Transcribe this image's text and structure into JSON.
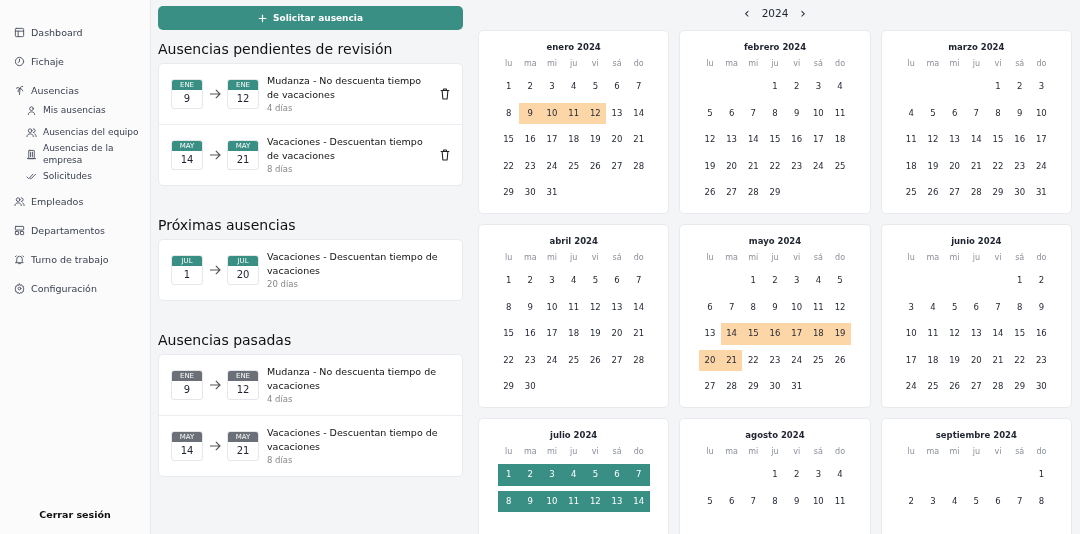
{
  "sidebar": {
    "items": [
      {
        "label": "Dashboard"
      },
      {
        "label": "Fichaje"
      },
      {
        "label": "Ausencias",
        "children": [
          {
            "label": "Mis ausencias"
          },
          {
            "label": "Ausencias del equipo"
          },
          {
            "label": "Ausencias de la empresa"
          },
          {
            "label": "Solicitudes"
          }
        ]
      },
      {
        "label": "Empleados"
      },
      {
        "label": "Departamentos"
      },
      {
        "label": "Turno de trabajo"
      },
      {
        "label": "Configuración"
      }
    ],
    "logout": "Cerrar sesión"
  },
  "request_button": "Solicitar ausencia",
  "sections": [
    {
      "title": "Ausencias pendientes de revisión",
      "kind": "pending",
      "items": [
        {
          "from": {
            "month": "ENE",
            "day": "9"
          },
          "to": {
            "month": "ENE",
            "day": "12"
          },
          "title": "Mudanza - No descuenta tiempo de vacaciones",
          "duration": "4 días",
          "deletable": true
        },
        {
          "from": {
            "month": "MAY",
            "day": "14"
          },
          "to": {
            "month": "MAY",
            "day": "21"
          },
          "title": "Vacaciones - Descuentan tiempo de vacaciones",
          "duration": "8 días",
          "deletable": true
        }
      ]
    },
    {
      "title": "Próximas ausencias",
      "kind": "upcoming",
      "items": [
        {
          "from": {
            "month": "JUL",
            "day": "1"
          },
          "to": {
            "month": "JUL",
            "day": "20"
          },
          "title": "Vacaciones - Descuentan tiempo de vacaciones",
          "duration": "20 días",
          "deletable": false
        }
      ]
    },
    {
      "title": "Ausencias pasadas",
      "kind": "past",
      "items": [
        {
          "from": {
            "month": "ENE",
            "day": "9"
          },
          "to": {
            "month": "ENE",
            "day": "12"
          },
          "title": "Mudanza - No descuenta tiempo de vacaciones",
          "duration": "4 días",
          "deletable": false
        },
        {
          "from": {
            "month": "MAY",
            "day": "14"
          },
          "to": {
            "month": "MAY",
            "day": "21"
          },
          "title": "Vacaciones - Descuentan tiempo de vacaciones",
          "duration": "8 días",
          "deletable": false
        }
      ]
    }
  ],
  "calendar": {
    "prev": "‹",
    "year": "2024",
    "next": "›",
    "months": [
      {
        "title": "enero 2024",
        "color": "#fdd6a8",
        "weekdays": [
          "lu",
          "ma",
          "mi",
          "ju",
          "vi",
          "sá",
          "do"
        ],
        "weeks": [
          {
            "kind": "full",
            "days": [
              {
                "d": "1",
                "marked": false
              },
              {
                "d": "2",
                "marked": false
              },
              {
                "d": "3",
                "marked": false
              },
              {
                "d": "4",
                "marked": false
              },
              {
                "d": "5",
                "marked": false
              },
              {
                "d": "6",
                "marked": false
              },
              {
                "d": "7",
                "marked": false
              }
            ]
          },
          {
            "kind": "full",
            "days": [
              {
                "d": "8",
                "marked": false
              },
              {
                "d": "9",
                "marked": true
              },
              {
                "d": "10",
                "marked": true
              },
              {
                "d": "11",
                "marked": true
              },
              {
                "d": "12",
                "marked": true
              },
              {
                "d": "13",
                "marked": false
              },
              {
                "d": "14",
                "marked": false
              }
            ]
          },
          {
            "kind": "full",
            "days": [
              {
                "d": "15",
                "marked": false
              },
              {
                "d": "16",
                "marked": false
              },
              {
                "d": "17",
                "marked": false
              },
              {
                "d": "18",
                "marked": false
              },
              {
                "d": "19",
                "marked": false
              },
              {
                "d": "20",
                "marked": false
              },
              {
                "d": "21",
                "marked": false
              }
            ]
          },
          {
            "kind": "full",
            "days": [
              {
                "d": "22",
                "marked": false
              },
              {
                "d": "23",
                "marked": false
              },
              {
                "d": "24",
                "marked": false
              },
              {
                "d": "25",
                "marked": false
              },
              {
                "d": "26",
                "marked": false
              },
              {
                "d": "27",
                "marked": false
              },
              {
                "d": "28",
                "marked": false
              }
            ]
          },
          {
            "kind": "full",
            "days": [
              {
                "d": "29",
                "marked": false
              },
              {
                "d": "30",
                "marked": false
              },
              {
                "d": "31",
                "marked": false
              }
            ]
          }
        ]
      },
      {
        "title": "febrero 2024",
        "weekdays": [
          "lu",
          "ma",
          "mi",
          "ju",
          "vi",
          "sá",
          "do"
        ],
        "weeks": [
          {
            "kind": "leading",
            "days": [
              {
                "d": "1",
                "marked": false
              },
              {
                "d": "2",
                "marked": false
              },
              {
                "d": "3",
                "marked": false
              },
              {
                "d": "4",
                "marked": false
              }
            ]
          },
          {
            "kind": "full",
            "days": [
              {
                "d": "5",
                "marked": false
              },
              {
                "d": "6",
                "marked": false
              },
              {
                "d": "7",
                "marked": false
              },
              {
                "d": "8",
                "marked": false
              },
              {
                "d": "9",
                "marked": false
              },
              {
                "d": "10",
                "marked": false
              },
              {
                "d": "11",
                "marked": false
              }
            ]
          },
          {
            "kind": "full",
            "days": [
              {
                "d": "12",
                "marked": false
              },
              {
                "d": "13",
                "marked": false
              },
              {
                "d": "14",
                "marked": false
              },
              {
                "d": "15",
                "marked": false
              },
              {
                "d": "16",
                "marked": false
              },
              {
                "d": "17",
                "marked": false
              },
              {
                "d": "18",
                "marked": false
              }
            ]
          },
          {
            "kind": "full",
            "days": [
              {
                "d": "19",
                "marked": false
              },
              {
                "d": "20",
                "marked": false
              },
              {
                "d": "21",
                "marked": false
              },
              {
                "d": "22",
                "marked": false
              },
              {
                "d": "23",
                "marked": false
              },
              {
                "d": "24",
                "marked": false
              },
              {
                "d": "25",
                "marked": false
              }
            ]
          },
          {
            "kind": "full",
            "days": [
              {
                "d": "26",
                "marked": false
              },
              {
                "d": "27",
                "marked": false
              },
              {
                "d": "28",
                "marked": false
              },
              {
                "d": "29",
                "marked": false
              }
            ]
          }
        ]
      },
      {
        "title": "marzo 2024",
        "weekdays": [
          "lu",
          "ma",
          "mi",
          "ju",
          "vi",
          "sá",
          "do"
        ],
        "weeks": [
          {
            "kind": "leading",
            "days": [
              {
                "d": "1",
                "marked": false
              },
              {
                "d": "2",
                "marked": false
              },
              {
                "d": "3",
                "marked": false
              }
            ]
          },
          {
            "kind": "full",
            "days": [
              {
                "d": "4",
                "marked": false
              },
              {
                "d": "5",
                "marked": false
              },
              {
                "d": "6",
                "marked": false
              },
              {
                "d": "7",
                "marked": false
              },
              {
                "d": "8",
                "marked": false
              },
              {
                "d": "9",
                "marked": false
              },
              {
                "d": "10",
                "marked": false
              }
            ]
          },
          {
            "kind": "full",
            "days": [
              {
                "d": "11",
                "marked": false
              },
              {
                "d": "12",
                "marked": false
              },
              {
                "d": "13",
                "marked": false
              },
              {
                "d": "14",
                "marked": false
              },
              {
                "d": "15",
                "marked": false
              },
              {
                "d": "16",
                "marked": false
              },
              {
                "d": "17",
                "marked": false
              }
            ]
          },
          {
            "kind": "full",
            "days": [
              {
                "d": "18",
                "marked": false
              },
              {
                "d": "19",
                "marked": false
              },
              {
                "d": "20",
                "marked": false
              },
              {
                "d": "21",
                "marked": false
              },
              {
                "d": "22",
                "marked": false
              },
              {
                "d": "23",
                "marked": false
              },
              {
                "d": "24",
                "marked": false
              }
            ]
          },
          {
            "kind": "full",
            "days": [
              {
                "d": "25",
                "marked": false
              },
              {
                "d": "26",
                "marked": false
              },
              {
                "d": "27",
                "marked": false
              },
              {
                "d": "28",
                "marked": false
              },
              {
                "d": "29",
                "marked": false
              },
              {
                "d": "30",
                "marked": false
              },
              {
                "d": "31",
                "marked": false
              }
            ]
          }
        ]
      },
      {
        "title": "abril 2024",
        "weekdays": [
          "lu",
          "ma",
          "mi",
          "ju",
          "vi",
          "sá",
          "do"
        ],
        "weeks": [
          {
            "kind": "full",
            "days": [
              {
                "d": "1",
                "marked": false
              },
              {
                "d": "2",
                "marked": false
              },
              {
                "d": "3",
                "marked": false
              },
              {
                "d": "4",
                "marked": false
              },
              {
                "d": "5",
                "marked": false
              },
              {
                "d": "6",
                "marked": false
              },
              {
                "d": "7",
                "marked": false
              }
            ]
          },
          {
            "kind": "full",
            "days": [
              {
                "d": "8",
                "marked": false
              },
              {
                "d": "9",
                "marked": false
              },
              {
                "d": "10",
                "marked": false
              },
              {
                "d": "11",
                "marked": false
              },
              {
                "d": "12",
                "marked": false
              },
              {
                "d": "13",
                "marked": false
              },
              {
                "d": "14",
                "marked": false
              }
            ]
          },
          {
            "kind": "full",
            "days": [
              {
                "d": "15",
                "marked": false
              },
              {
                "d": "16",
                "marked": false
              },
              {
                "d": "17",
                "marked": false
              },
              {
                "d": "18",
                "marked": false
              },
              {
                "d": "19",
                "marked": false
              },
              {
                "d": "20",
                "marked": false
              },
              {
                "d": "21",
                "marked": false
              }
            ]
          },
          {
            "kind": "full",
            "days": [
              {
                "d": "22",
                "marked": false
              },
              {
                "d": "23",
                "marked": false
              },
              {
                "d": "24",
                "marked": false
              },
              {
                "d": "25",
                "marked": false
              },
              {
                "d": "26",
                "marked": false
              },
              {
                "d": "27",
                "marked": false
              },
              {
                "d": "28",
                "marked": false
              }
            ]
          },
          {
            "kind": "full",
            "days": [
              {
                "d": "29",
                "marked": false
              },
              {
                "d": "30",
                "marked": false
              }
            ]
          }
        ]
      },
      {
        "title": "mayo 2024",
        "color": "#fdd6a8",
        "weekdays": [
          "lu",
          "ma",
          "mi",
          "ju",
          "vi",
          "sá",
          "do"
        ],
        "weeks": [
          {
            "kind": "leading",
            "days": [
              {
                "d": "1",
                "marked": false
              },
              {
                "d": "2",
                "marked": false
              },
              {
                "d": "3",
                "marked": false
              },
              {
                "d": "4",
                "marked": false
              },
              {
                "d": "5",
                "marked": false
              }
            ]
          },
          {
            "kind": "full",
            "days": [
              {
                "d": "6",
                "marked": false
              },
              {
                "d": "7",
                "marked": false
              },
              {
                "d": "8",
                "marked": false
              },
              {
                "d": "9",
                "marked": false
              },
              {
                "d": "10",
                "marked": false
              },
              {
                "d": "11",
                "marked": false
              },
              {
                "d": "12",
                "marked": false
              }
            ]
          },
          {
            "kind": "full",
            "days": [
              {
                "d": "13",
                "marked": false
              },
              {
                "d": "14",
                "marked": true
              },
              {
                "d": "15",
                "marked": true
              },
              {
                "d": "16",
                "marked": true
              },
              {
                "d": "17",
                "marked": true
              },
              {
                "d": "18",
                "marked": true
              },
              {
                "d": "19",
                "marked": true
              }
            ]
          },
          {
            "kind": "full",
            "days": [
              {
                "d": "20",
                "marked": true
              },
              {
                "d": "21",
                "marked": true
              },
              {
                "d": "22",
                "marked": false
              },
              {
                "d": "23",
                "marked": false
              },
              {
                "d": "24",
                "marked": false
              },
              {
                "d": "25",
                "marked": false
              },
              {
                "d": "26",
                "marked": false
              }
            ]
          },
          {
            "kind": "full",
            "days": [
              {
                "d": "27",
                "marked": false
              },
              {
                "d": "28",
                "marked": false
              },
              {
                "d": "29",
                "marked": false
              },
              {
                "d": "30",
                "marked": false
              },
              {
                "d": "31",
                "marked": false
              }
            ]
          }
        ]
      },
      {
        "title": "junio 2024",
        "weekdays": [
          "lu",
          "ma",
          "mi",
          "ju",
          "vi",
          "sá",
          "do"
        ],
        "weeks": [
          {
            "kind": "leading",
            "days": [
              {
                "d": "1",
                "marked": false
              },
              {
                "d": "2",
                "marked": false
              }
            ]
          },
          {
            "kind": "full",
            "days": [
              {
                "d": "3",
                "marked": false
              },
              {
                "d": "4",
                "marked": false
              },
              {
                "d": "5",
                "marked": false
              },
              {
                "d": "6",
                "marked": false
              },
              {
                "d": "7",
                "marked": false
              },
              {
                "d": "8",
                "marked": false
              },
              {
                "d": "9",
                "marked": false
              }
            ]
          },
          {
            "kind": "full",
            "days": [
              {
                "d": "10",
                "marked": false
              },
              {
                "d": "11",
                "marked": false
              },
              {
                "d": "12",
                "marked": false
              },
              {
                "d": "13",
                "marked": false
              },
              {
                "d": "14",
                "marked": false
              },
              {
                "d": "15",
                "marked": false
              },
              {
                "d": "16",
                "marked": false
              }
            ]
          },
          {
            "kind": "full",
            "days": [
              {
                "d": "17",
                "marked": false
              },
              {
                "d": "18",
                "marked": false
              },
              {
                "d": "19",
                "marked": false
              },
              {
                "d": "20",
                "marked": false
              },
              {
                "d": "21",
                "marked": false
              },
              {
                "d": "22",
                "marked": false
              },
              {
                "d": "23",
                "marked": false
              }
            ]
          },
          {
            "kind": "full",
            "days": [
              {
                "d": "24",
                "marked": false
              },
              {
                "d": "25",
                "marked": false
              },
              {
                "d": "26",
                "marked": false
              },
              {
                "d": "27",
                "marked": false
              },
              {
                "d": "28",
                "marked": false
              },
              {
                "d": "29",
                "marked": false
              },
              {
                "d": "30",
                "marked": false
              }
            ]
          }
        ]
      },
      {
        "title": "julio 2024",
        "color": "#3a8f85",
        "weekdays": [
          "lu",
          "ma",
          "mi",
          "ju",
          "vi",
          "sá",
          "do"
        ],
        "weeks": [
          {
            "kind": "full",
            "days": [
              {
                "d": "1",
                "marked": true
              },
              {
                "d": "2",
                "marked": true
              },
              {
                "d": "3",
                "marked": true
              },
              {
                "d": "4",
                "marked": true
              },
              {
                "d": "5",
                "marked": true
              },
              {
                "d": "6",
                "marked": true
              },
              {
                "d": "7",
                "marked": true
              }
            ]
          },
          {
            "kind": "full",
            "days": [
              {
                "d": "8",
                "marked": true
              },
              {
                "d": "9",
                "marked": true
              },
              {
                "d": "10",
                "marked": true
              },
              {
                "d": "11",
                "marked": true
              },
              {
                "d": "12",
                "marked": true
              },
              {
                "d": "13",
                "marked": true
              },
              {
                "d": "14",
                "marked": true
              }
            ]
          }
        ]
      },
      {
        "title": "agosto 2024",
        "weekdays": [
          "lu",
          "ma",
          "mi",
          "ju",
          "vi",
          "sá",
          "do"
        ],
        "weeks": [
          {
            "kind": "leading",
            "days": [
              {
                "d": "1",
                "marked": false
              },
              {
                "d": "2",
                "marked": false
              },
              {
                "d": "3",
                "marked": false
              },
              {
                "d": "4",
                "marked": false
              }
            ]
          },
          {
            "kind": "full",
            "days": [
              {
                "d": "5",
                "marked": false
              },
              {
                "d": "6",
                "marked": false
              },
              {
                "d": "7",
                "marked": false
              },
              {
                "d": "8",
                "marked": false
              },
              {
                "d": "9",
                "marked": false
              },
              {
                "d": "10",
                "marked": false
              },
              {
                "d": "11",
                "marked": false
              }
            ]
          }
        ]
      },
      {
        "title": "septiembre 2024",
        "weekdays": [
          "lu",
          "ma",
          "mi",
          "ju",
          "vi",
          "sá",
          "do"
        ],
        "weeks": [
          {
            "kind": "leading",
            "days": [
              {
                "d": "1",
                "marked": false
              }
            ]
          },
          {
            "kind": "full",
            "days": [
              {
                "d": "2",
                "marked": false
              },
              {
                "d": "3",
                "marked": false
              },
              {
                "d": "4",
                "marked": false
              },
              {
                "d": "5",
                "marked": false
              },
              {
                "d": "6",
                "marked": false
              },
              {
                "d": "7",
                "marked": false
              },
              {
                "d": "8",
                "marked": false
              }
            ]
          }
        ]
      }
    ]
  }
}
